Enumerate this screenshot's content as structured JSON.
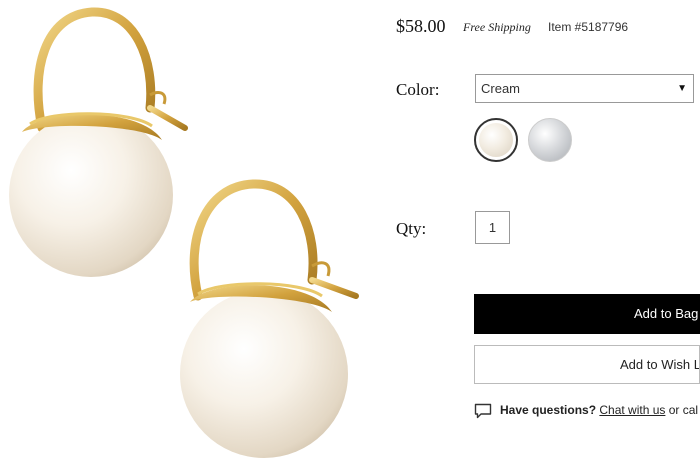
{
  "product": {
    "image_alt": "pearl-drop-earrings",
    "price": "$58.00",
    "shipping": "Free Shipping",
    "item_number": "Item #5187796"
  },
  "color": {
    "label": "Color:",
    "selected": "Cream",
    "swatches": [
      {
        "name": "cream",
        "hex": "#efe8dc",
        "selected": true
      },
      {
        "name": "silver",
        "hex": "#c8cbcf",
        "selected": false
      }
    ]
  },
  "quantity": {
    "label": "Qty:",
    "value": "1"
  },
  "actions": {
    "add_to_bag": "Add to Bag",
    "add_to_wish_list": "Add to Wish Lis"
  },
  "help": {
    "prompt": "Have questions?",
    "chat_link": "Chat with us",
    "tail": " or cal"
  },
  "colors": {
    "button_primary": "#000000",
    "gold": "#d4a63f",
    "pearl": "#f4efe6"
  }
}
